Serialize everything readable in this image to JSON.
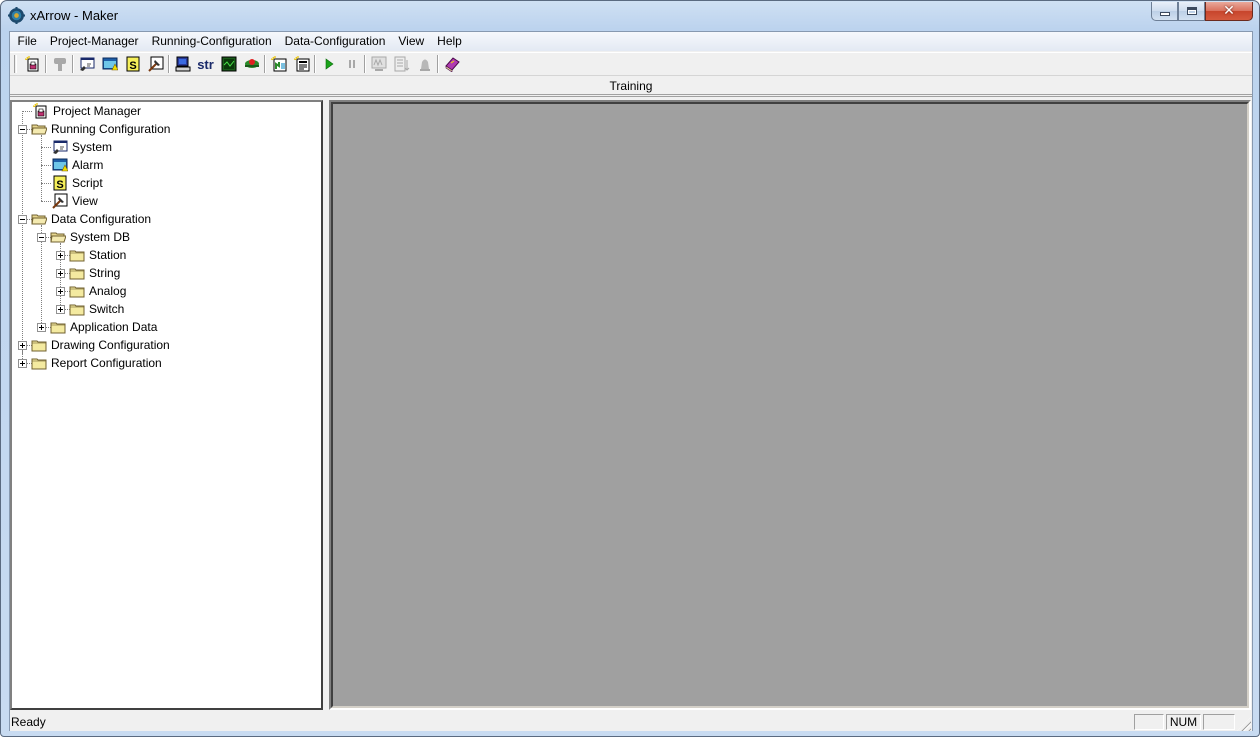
{
  "window": {
    "title": "xArrow - Maker",
    "app_icon": "xarrow-gear-icon",
    "controls": {
      "minimize": "minimize-icon",
      "maximize": "maximize-icon",
      "close": "close-icon"
    }
  },
  "menubar": {
    "items": [
      {
        "label": "File"
      },
      {
        "label": "Project-Manager"
      },
      {
        "label": "Running-Configuration"
      },
      {
        "label": "Data-Configuration"
      },
      {
        "label": "View"
      },
      {
        "label": "Help"
      }
    ]
  },
  "toolbar": {
    "buttons": [
      {
        "icon": "new-project-icon",
        "enabled": true
      },
      {
        "icon": "separator"
      },
      {
        "icon": "hammer-tool-icon",
        "enabled": false
      },
      {
        "icon": "separator"
      },
      {
        "icon": "system-config-icon",
        "enabled": true
      },
      {
        "icon": "alarm-config-icon",
        "enabled": true
      },
      {
        "icon": "script-icon",
        "enabled": true
      },
      {
        "icon": "view-icon",
        "enabled": true
      },
      {
        "icon": "separator"
      },
      {
        "icon": "computer-icon",
        "enabled": true
      },
      {
        "icon": "string-icon",
        "text": "str",
        "enabled": true
      },
      {
        "icon": "analog-monitor-icon",
        "enabled": true
      },
      {
        "icon": "switch-traffic-light-icon",
        "enabled": true
      },
      {
        "icon": "separator"
      },
      {
        "icon": "new-drawing-icon",
        "enabled": true
      },
      {
        "icon": "new-report-icon",
        "enabled": true
      },
      {
        "icon": "separator"
      },
      {
        "icon": "run-play-icon",
        "enabled": true
      },
      {
        "icon": "pause-icon",
        "enabled": false
      },
      {
        "icon": "separator"
      },
      {
        "icon": "monitor-trend-icon",
        "enabled": false
      },
      {
        "icon": "list-download-icon",
        "enabled": false
      },
      {
        "icon": "bell-icon",
        "enabled": false
      },
      {
        "icon": "separator"
      },
      {
        "icon": "help-book-icon",
        "enabled": true
      }
    ]
  },
  "caption": {
    "title": "Training"
  },
  "tree": {
    "items": [
      {
        "label": "Project Manager",
        "icon": "project-icon",
        "level": 0,
        "expander": "none"
      },
      {
        "label": "Running Configuration",
        "icon": "folder-open-icon",
        "level": 0,
        "expander": "minus"
      },
      {
        "label": "System",
        "icon": "system-config-icon",
        "level": 1,
        "expander": "none"
      },
      {
        "label": "Alarm",
        "icon": "alarm-config-icon",
        "level": 1,
        "expander": "none"
      },
      {
        "label": "Script",
        "icon": "script-icon",
        "level": 1,
        "expander": "none"
      },
      {
        "label": "View",
        "icon": "view-icon",
        "level": 1,
        "expander": "none"
      },
      {
        "label": "Data Configuration",
        "icon": "folder-open-icon",
        "level": 0,
        "expander": "minus"
      },
      {
        "label": "System DB",
        "icon": "folder-open-icon",
        "level": 1,
        "expander": "minus"
      },
      {
        "label": "Station",
        "icon": "folder-icon",
        "level": 2,
        "expander": "plus"
      },
      {
        "label": "String",
        "icon": "folder-icon",
        "level": 2,
        "expander": "plus"
      },
      {
        "label": "Analog",
        "icon": "folder-icon",
        "level": 2,
        "expander": "plus"
      },
      {
        "label": "Switch",
        "icon": "folder-icon",
        "level": 2,
        "expander": "plus"
      },
      {
        "label": "Application Data",
        "icon": "folder-icon",
        "level": 1,
        "expander": "plus"
      },
      {
        "label": "Drawing Configuration",
        "icon": "folder-icon",
        "level": 0,
        "expander": "plus"
      },
      {
        "label": "Report Configuration",
        "icon": "folder-icon",
        "level": 0,
        "expander": "plus"
      }
    ]
  },
  "statusbar": {
    "text": "Ready",
    "panes": [
      "",
      "NUM",
      ""
    ]
  },
  "colors": {
    "mdi_background": "#a0a0a0",
    "chrome": "#f0f0f0",
    "close_button": "#c7452c",
    "play_green": "#1aa31a"
  }
}
